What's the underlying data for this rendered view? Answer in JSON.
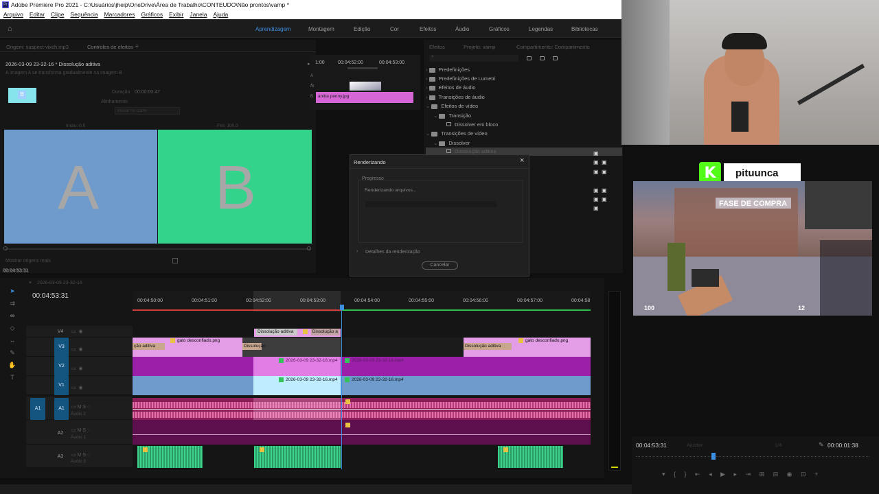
{
  "window": {
    "title": "Adobe Premiere Pro 2021 - C:\\Usuários\\jheip\\OneDrive\\Área de Trabalho\\CONTEUDO\\Não prontos\\vamp *",
    "logo": "Pr"
  },
  "menu": [
    "Arquivo",
    "Editar",
    "Clipe",
    "Sequência",
    "Marcadores",
    "Gráficos",
    "Exibir",
    "Janela",
    "Ajuda"
  ],
  "workspaces": {
    "items": [
      "Aprendizagem",
      "Montagem",
      "Edição",
      "Cor",
      "Efeitos",
      "Áudio",
      "Gráficos",
      "Legendas",
      "Bibliotecas"
    ],
    "active": "Aprendizagem"
  },
  "source_panel": {
    "tab_source": "Origem: suspect-vixch.mp3",
    "tab_effects": "Controles de efeitos",
    "sequence_name": "2026-03-09 23-32-16 * Dissolução aditiva",
    "description": "A imagem A se transforma gradualmente na imagem B",
    "duration_label": "Duração",
    "duration_value": "00:00:00:47",
    "alignment_label": "Alinhamento",
    "alignment_value": "Iniciar no corte",
    "start_label": "Início: 0,0",
    "end_label": "Fim: 100,0",
    "show_real_sources": "Mostrar origens reais",
    "a_letter": "A",
    "b_letter": "B",
    "thumb_letter": "B",
    "timecode": "00:04:53:31"
  },
  "mini_timeline": {
    "t1": "1:00",
    "t2": "00:04:52:00",
    "t3": "00:04:53:00",
    "clip": "anitta penny.jpg",
    "track_a": "A",
    "track_b": "B"
  },
  "effects_panel": {
    "tabs": [
      "Efeitos",
      "Projeto: vamp",
      "Compartimento: Compartimento"
    ],
    "items": [
      {
        "label": "Predefinições",
        "indent": 0
      },
      {
        "label": "Predefinições de Lumetri",
        "indent": 0
      },
      {
        "label": "Efeitos de áudio",
        "indent": 0
      },
      {
        "label": "Transições de áudio",
        "indent": 0
      },
      {
        "label": "Efeitos de vídeo",
        "indent": 0
      },
      {
        "label": "Transição",
        "indent": 1
      },
      {
        "label": "Dissolver em bloco",
        "indent": 2
      },
      {
        "label": "Transições de vídeo",
        "indent": 0
      },
      {
        "label": "Dissolver",
        "indent": 1
      },
      {
        "label": "Dissolução aditiva",
        "indent": 2
      }
    ]
  },
  "render_dialog": {
    "title": "Renderizando",
    "section": "Progresso",
    "status": "Renderizando arquivos...",
    "progress": 0,
    "details": "Detalhes da renderização",
    "cancel": "Cancelar"
  },
  "timeline": {
    "tab": "2026-03-09 23-32-16",
    "timecode": "00:04:53:31",
    "ruler": [
      "00:04:50:00",
      "00:04:51:00",
      "00:04:52:00",
      "00:04:53:00",
      "00:04:54:00",
      "00:04:55:00",
      "00:04:56:00",
      "00:04:57:00",
      "00:04:58"
    ],
    "tracks": {
      "v4": "V4",
      "v3": "V3",
      "v2": "V2",
      "v1": "V1",
      "a1_src": "A1",
      "a1": "A1",
      "a2": "A2",
      "a3": "A3",
      "audio2": "Áudio 2",
      "audio1": "Áudio 1",
      "audio3": "Áudio 3"
    },
    "clips": {
      "dissolve": "Dissolução aditiva",
      "dissolve_short": "Dissolução",
      "gato": "gato desconfiado.png",
      "ao_aditiva": "ção aditiva",
      "video": "2026-03-09 23-32-16.mp4",
      "video_dim": "2026-03-09 23-32-16.mp4",
      "dissolve_trunc": "Dissolução a"
    }
  },
  "program": {
    "timecode": "00:04:53:31",
    "fit": "Ajustar",
    "quality": "1/4",
    "duration": "00:00:01:38"
  },
  "stream": {
    "name": "pituunca",
    "logo": "K",
    "game_banner": "FASE DE COMPRA",
    "hp": "100",
    "ammo": "12"
  },
  "colors": {
    "pink": "#d666d6",
    "purple": "#9b1fa8",
    "blue": "#6f9bcc",
    "green": "#3ecf8a",
    "accent": "#3b8ee0"
  }
}
